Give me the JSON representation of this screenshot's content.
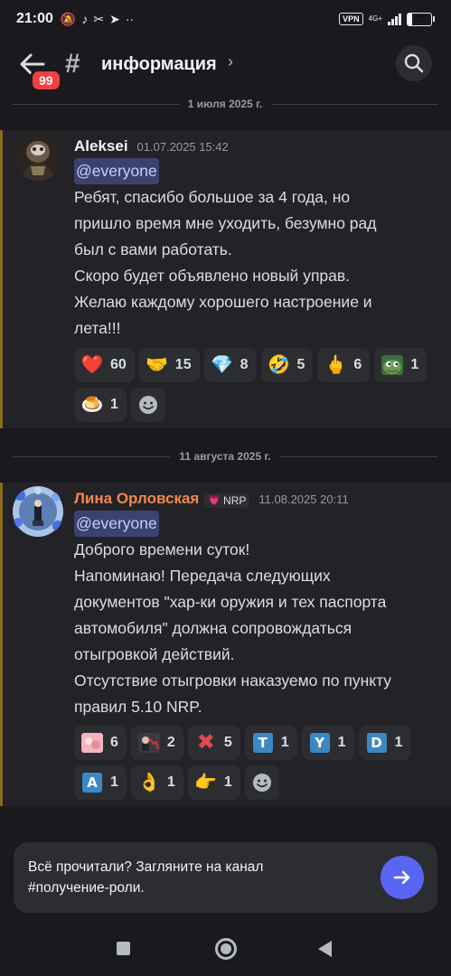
{
  "status_bar": {
    "time": "21:00",
    "vpn": "VPN",
    "network": "4G+",
    "battery_level": "21",
    "battery_fraction": 0.21,
    "icons": [
      "dnd-icon",
      "tiktok-icon",
      "scissors-icon",
      "telegram-icon",
      "more-icon"
    ]
  },
  "header": {
    "unread_badge": "99",
    "channel_name": "информация",
    "icons": [
      "back-arrow-icon",
      "hash-icon",
      "chevron-right-icon",
      "search-icon"
    ]
  },
  "dividers": [
    "1 июля 2025 г.",
    "11 августа 2025 г."
  ],
  "messages": [
    {
      "author": "Aleksei",
      "timestamp": "01.07.2025 15:42",
      "mention": "@everyone",
      "lines": [
        "Ребят, спасибо большое за 4 года, но",
        "пришло время мне уходить, безумно рад",
        "был с вами работать.",
        "Скоро будет объявлено новый управ.",
        "Желаю каждому хорошего настроение и",
        "лета!!!"
      ],
      "reactions": [
        {
          "icon": "heart",
          "count": "60"
        },
        {
          "icon": "handshake",
          "count": "15"
        },
        {
          "icon": "gem",
          "count": "8"
        },
        {
          "icon": "rofl",
          "count": "5"
        },
        {
          "icon": "middle-finger",
          "count": "6"
        },
        {
          "icon": "pepe",
          "count": "1"
        },
        {
          "icon": "flan",
          "count": "1"
        }
      ]
    },
    {
      "author": "Лина Орловская",
      "author_color": "#f0884d",
      "tag": "NRP",
      "timestamp": "11.08.2025 20:11",
      "mention": "@everyone",
      "lines": [
        "Доброго времени суток!",
        "Напоминаю! Передача следующих",
        "документов \"хар-ки оружия и тех паспорта",
        "автомобиля\" должна сопровождаться",
        "отыгровкой действий.",
        "Отсутствие отыгровки наказуемо по пункту",
        "правил 5.10 NRP."
      ],
      "reactions": [
        {
          "icon": "pink-image",
          "count": "6"
        },
        {
          "icon": "stonks-down",
          "count": "2"
        },
        {
          "icon": "cross-mark",
          "count": "5"
        },
        {
          "icon": "letter-t",
          "letter": "T",
          "count": "1"
        },
        {
          "icon": "letter-y",
          "letter": "Y",
          "count": "1"
        },
        {
          "icon": "letter-d",
          "letter": "D",
          "count": "1"
        },
        {
          "icon": "letter-a",
          "letter": "A",
          "count": "1"
        },
        {
          "icon": "ok-hand",
          "count": "1"
        },
        {
          "icon": "point-right",
          "count": "1"
        }
      ]
    }
  ],
  "banner": {
    "line1": "Всё прочитали? Загляните на канал",
    "line2": "#получение-роли."
  },
  "colors": {
    "background": "#1a1a1e",
    "message_bg": "#232227",
    "accent": "#5865f2",
    "mention_bg": "#3c4270",
    "badge": "#f23f43"
  }
}
